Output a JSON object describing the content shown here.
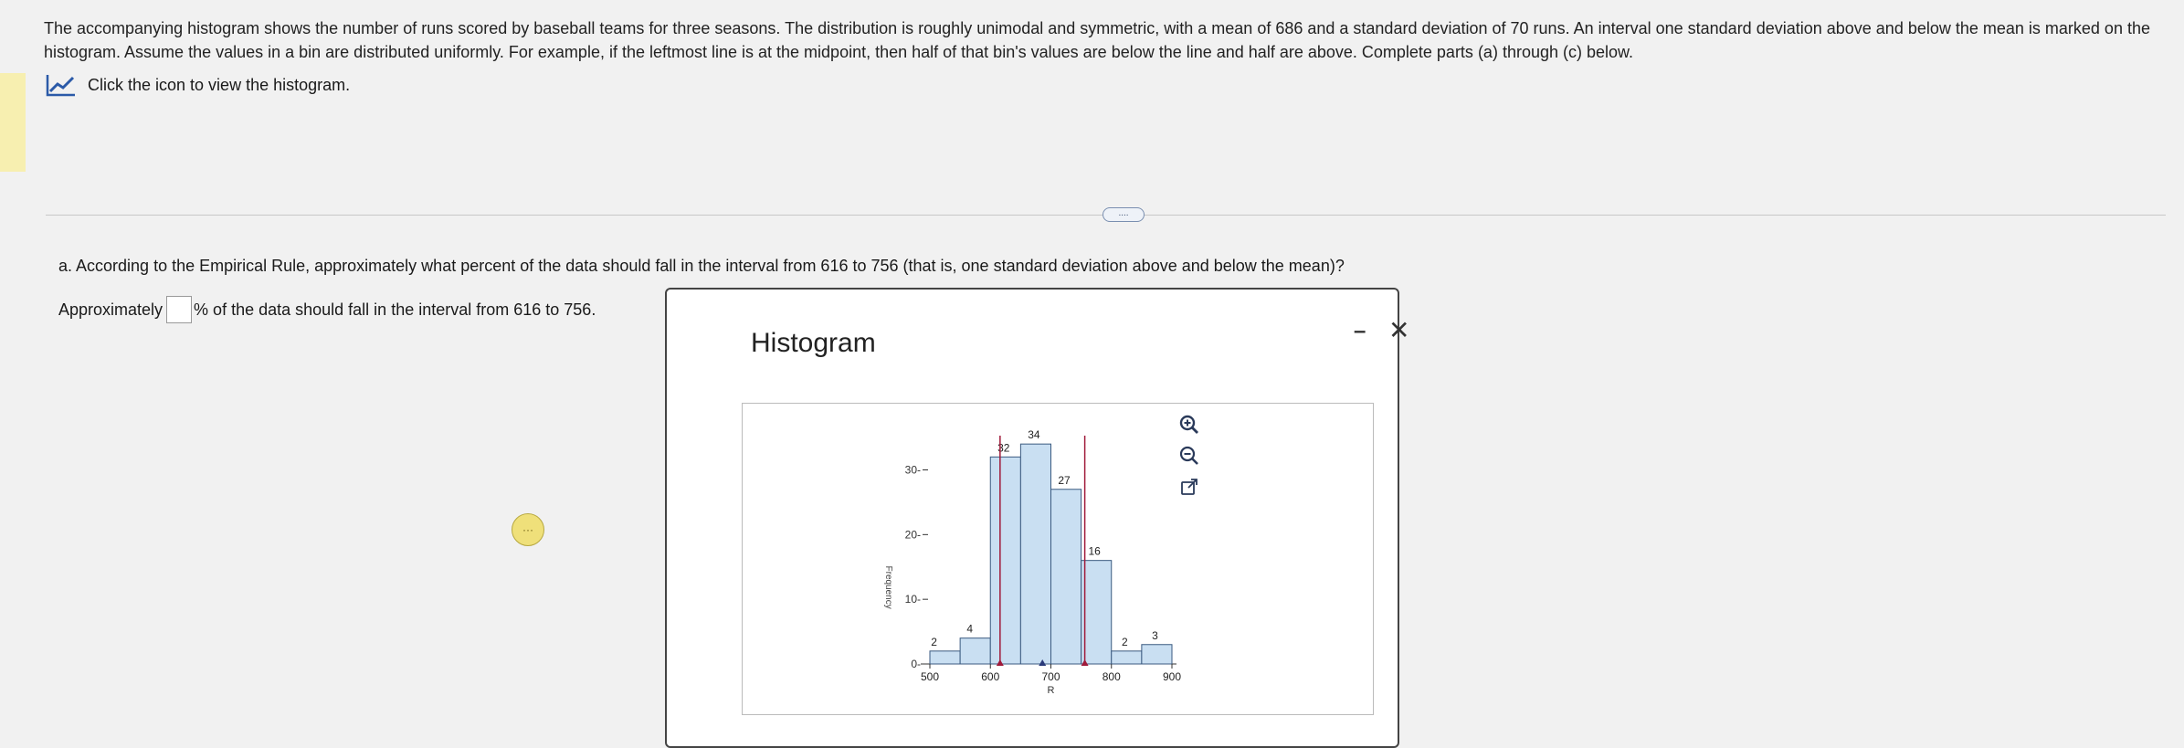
{
  "intro": "The accompanying histogram shows the number of runs scored by baseball teams for three seasons. The distribution is roughly unimodal and symmetric, with a mean of 686 and a standard deviation of 70 runs. An interval one standard deviation above and below the mean is marked on the histogram. Assume the values in a bin are distributed uniformly. For example, if the leftmost line is at the midpoint, then half of that bin's values are below the line and half are above. Complete parts (a) through (c) below.",
  "icon_link": {
    "label": "Click the icon to view the histogram."
  },
  "more_button": "....",
  "question_a": "a. According to the Empirical Rule, approximately what percent of the data should fall in the interval from 616 to 756 (that is, one standard deviation above and below the mean)?",
  "answer": {
    "prefix": "Approximately",
    "value": "",
    "suffix": "% of the data should fall in the interval from 616 to 756."
  },
  "dialog": {
    "title": "Histogram",
    "minimize": "–",
    "close": "✕"
  },
  "colors": {
    "bar_fill": "#c9dff2",
    "bar_stroke": "#3a5a80",
    "marker_line": "#a01a3a",
    "mean_marker": "#2a3a7a"
  },
  "chart_data": {
    "type": "bar",
    "title": "",
    "ylabel": "Frequency",
    "xlabel": "R",
    "bins": [
      [
        500,
        550
      ],
      [
        550,
        600
      ],
      [
        600,
        650
      ],
      [
        650,
        700
      ],
      [
        700,
        750
      ],
      [
        750,
        800
      ],
      [
        800,
        850
      ],
      [
        850,
        900
      ]
    ],
    "values": [
      1,
      2,
      4,
      32,
      34,
      27,
      16,
      2,
      3
    ],
    "bar_labels": [
      "2",
      "4",
      "32",
      "34",
      "27",
      "16",
      "2",
      "3"
    ],
    "x_ticks": [
      500,
      600,
      700,
      800,
      900
    ],
    "y_ticks": [
      0,
      10,
      20,
      30
    ],
    "ylim": [
      0,
      36
    ],
    "xlim": [
      500,
      900
    ],
    "interval_lines": [
      616,
      756
    ],
    "mean": 686
  }
}
